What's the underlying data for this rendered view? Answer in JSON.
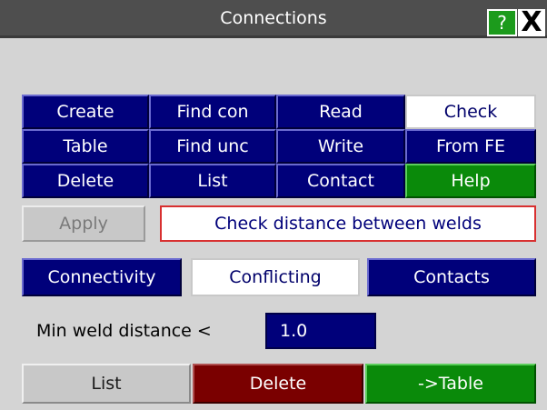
{
  "window": {
    "title": "Connections",
    "help_icon": "?",
    "close_icon": "X"
  },
  "main_buttons": {
    "create": "Create",
    "find_con": "Find con",
    "read": "Read",
    "check": "Check",
    "table": "Table",
    "find_unc": "Find unc",
    "write": "Write",
    "from_fe": "From FE",
    "delete": "Delete",
    "list": "List",
    "contact": "Contact",
    "help": "Help"
  },
  "action_row": {
    "apply": "Apply",
    "status": "Check distance between welds"
  },
  "tabs": {
    "connectivity": "Connectivity",
    "conflicting": "Conflicting",
    "contacts": "Contacts",
    "selected": "Conflicting"
  },
  "weld_distance": {
    "label": "Min weld distance <",
    "value": "1.0"
  },
  "bottom_buttons": {
    "list": "List",
    "delete": "Delete",
    "to_table": "->Table"
  },
  "colors": {
    "button_navy": "#00007a",
    "button_green": "#0a8a0a",
    "button_red": "#7a0000",
    "panel_bg": "#d4d4d4",
    "status_border": "#d83030"
  }
}
